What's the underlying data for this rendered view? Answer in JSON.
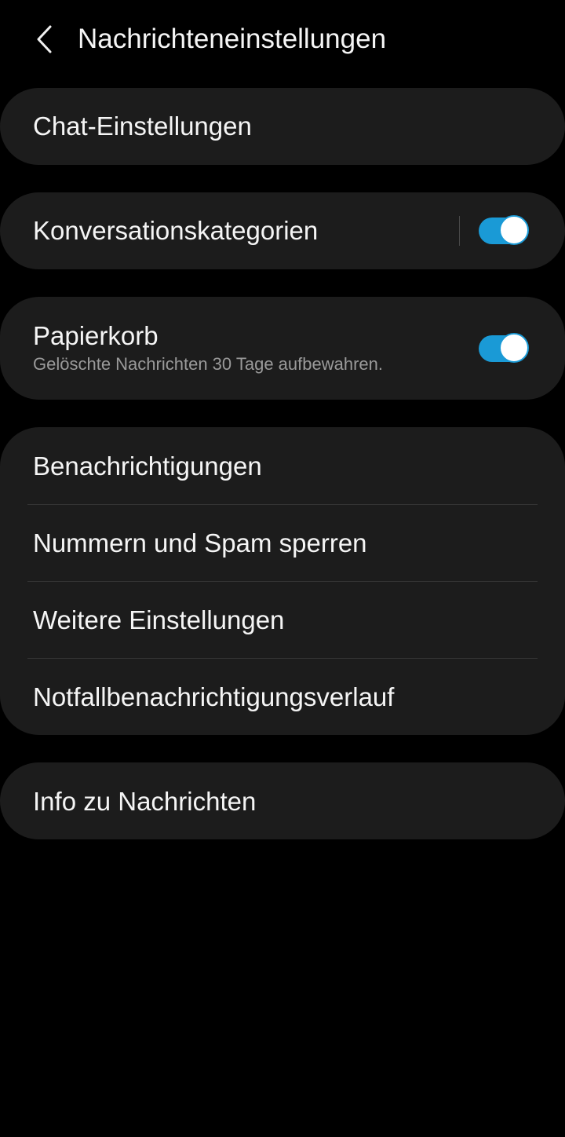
{
  "header": {
    "title": "Nachrichteneinstellungen",
    "back_icon": "chevron-left-icon"
  },
  "colors": {
    "background": "#000000",
    "card": "#1c1c1c",
    "accent": "#1a9ad6",
    "text_primary": "#f5f5f5",
    "text_secondary": "#9a9a9a"
  },
  "settings": {
    "chat": {
      "label": "Chat-Einstellungen"
    },
    "categories": {
      "label": "Konversationskategorien",
      "enabled": true
    },
    "trash": {
      "label": "Papierkorb",
      "description": "Gelöschte Nachrichten 30 Tage aufbewahren.",
      "enabled": true
    },
    "group": [
      {
        "label": "Benachrichtigungen"
      },
      {
        "label": "Nummern und Spam sperren"
      },
      {
        "label": "Weitere Einstellungen"
      },
      {
        "label": "Notfallbenachrichtigungsverlauf"
      }
    ],
    "about": {
      "label": "Info zu Nachrichten"
    }
  }
}
